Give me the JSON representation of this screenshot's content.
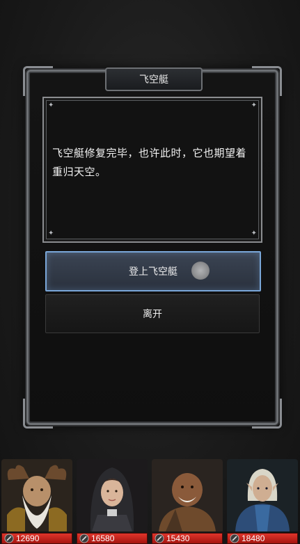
{
  "dialog": {
    "title": "飞空艇",
    "message": "飞空艇修复完毕，也许此时，它也期望着重归天空。",
    "options": [
      {
        "label": "登上飞空艇"
      },
      {
        "label": "离开"
      }
    ]
  },
  "party": [
    {
      "hp": "12690",
      "icon": "sword-icon"
    },
    {
      "hp": "16580",
      "icon": "sword-icon"
    },
    {
      "hp": "15430",
      "icon": "sword-icon"
    },
    {
      "hp": "18480",
      "icon": "sword-icon"
    }
  ],
  "colors": {
    "accent_border": "#7aa7d9",
    "hp_bar": "#d92a22"
  }
}
